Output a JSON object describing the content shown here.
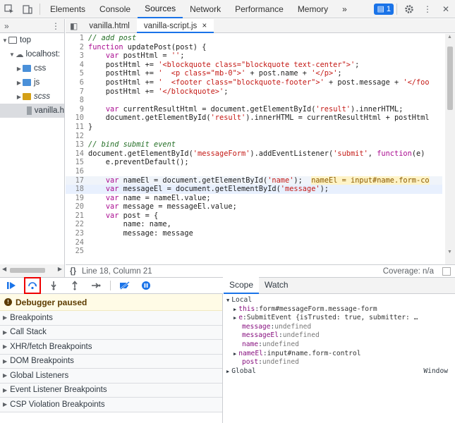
{
  "toolbar": {
    "tabs": [
      "Elements",
      "Console",
      "Sources",
      "Network",
      "Performance",
      "Memory"
    ],
    "active_tab": "Sources",
    "more": "»",
    "issues_count": "1"
  },
  "navigator": {
    "more": "»",
    "tree": [
      {
        "label": "top",
        "indent": 0,
        "type": "frame"
      },
      {
        "label": "localhost:",
        "indent": 1,
        "type": "cloud"
      },
      {
        "label": "css",
        "indent": 2,
        "type": "folder",
        "color": "#4a90d9"
      },
      {
        "label": "js",
        "indent": 2,
        "type": "folder",
        "color": "#4a90d9"
      },
      {
        "label": "scss",
        "indent": 2,
        "type": "folder",
        "color": "#d4a017"
      },
      {
        "label": "vanilla.h",
        "indent": 3,
        "type": "file"
      }
    ]
  },
  "editor": {
    "tabs": [
      "vanilla.html",
      "vanilla-script.js"
    ],
    "active_tab": "vanilla-script.js",
    "close": "×"
  },
  "code": [
    {
      "n": "1",
      "t": "// add post"
    },
    {
      "n": "2",
      "t": "function updatePost(post) {"
    },
    {
      "n": "3",
      "t": "    var postHtml = '';"
    },
    {
      "n": "4",
      "t": "    postHtml += '<blockquote class=\"blockquote text-center\">';"
    },
    {
      "n": "5",
      "t": "    postHtml += '  <p class=\"mb-0\">' + post.name + '</p>';"
    },
    {
      "n": "6",
      "t": "    postHtml += '  <footer class=\"blockquote-footer\">' + post.message + '</foo"
    },
    {
      "n": "7",
      "t": "    postHtml += '</blockquote>';"
    },
    {
      "n": "8",
      "t": ""
    },
    {
      "n": "9",
      "t": "    var currentResultHtml = document.getElementById('result').innerHTML;"
    },
    {
      "n": "10",
      "t": "    document.getElementById('result').innerHTML = currentResultHtml + postHtml"
    },
    {
      "n": "11",
      "t": "}"
    },
    {
      "n": "12",
      "t": ""
    },
    {
      "n": "13",
      "t": "// bind submit event"
    },
    {
      "n": "14",
      "t": "document.getElementById('messageForm').addEventListener('submit', function(e)"
    },
    {
      "n": "15",
      "t": "    e.preventDefault();"
    },
    {
      "n": "16",
      "t": ""
    },
    {
      "n": "17",
      "t": "    var nameEl = document.getElementById('name');"
    },
    {
      "n": "18",
      "t": "    var messageEl = document.getElementById('message');"
    },
    {
      "n": "19",
      "t": "    var name = nameEl.value;"
    },
    {
      "n": "20",
      "t": "    var message = messageEl.value;"
    },
    {
      "n": "21",
      "t": "    var post = {"
    },
    {
      "n": "22",
      "t": "        name: name,"
    },
    {
      "n": "23",
      "t": "        message: message"
    },
    {
      "n": "24",
      "t": ""
    },
    {
      "n": "25",
      "t": ""
    }
  ],
  "inline_value": "nameEl = input#name.form-co",
  "status": {
    "position": "Line 18, Column 21",
    "coverage": "Coverage: n/a"
  },
  "debugger": {
    "paused_label": "Debugger paused",
    "panes": [
      "Breakpoints",
      "Call Stack",
      "XHR/fetch Breakpoints",
      "DOM Breakpoints",
      "Global Listeners",
      "Event Listener Breakpoints",
      "CSP Violation Breakpoints"
    ]
  },
  "scope": {
    "tabs": [
      "Scope",
      "Watch"
    ],
    "local_label": "Local",
    "rows": [
      {
        "arrow": "▶",
        "key": "this",
        "val": "form#messageForm.message-form",
        "kind": "obj"
      },
      {
        "arrow": "▶",
        "key": "e",
        "val": "SubmitEvent {isTrusted: true, submitter: …",
        "kind": "obj"
      },
      {
        "arrow": "",
        "key": "message",
        "val": "undefined",
        "kind": "ud"
      },
      {
        "arrow": "",
        "key": "messageEl",
        "val": "undefined",
        "kind": "ud"
      },
      {
        "arrow": "",
        "key": "name",
        "val": "undefined",
        "kind": "ud"
      },
      {
        "arrow": "▶",
        "key": "nameEl",
        "val": "input#name.form-control",
        "kind": "obj"
      },
      {
        "arrow": "",
        "key": "post",
        "val": "undefined",
        "kind": "ud"
      }
    ],
    "global_label": "Global",
    "global_value": "Window"
  }
}
